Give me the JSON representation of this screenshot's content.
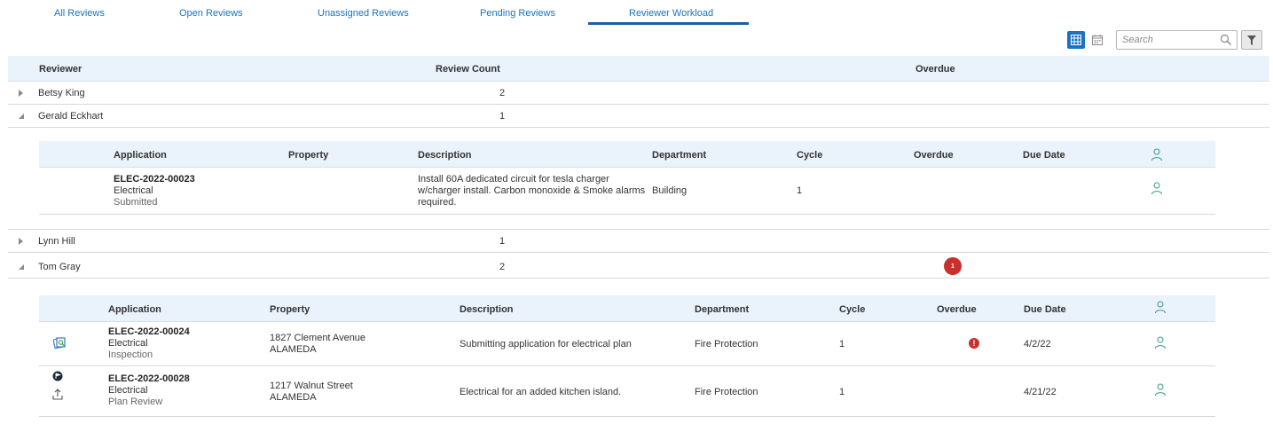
{
  "tabs": [
    {
      "label": "All Reviews"
    },
    {
      "label": "Open Reviews"
    },
    {
      "label": "Unassigned Reviews"
    },
    {
      "label": "Pending Reviews"
    },
    {
      "label": "Reviewer Workload",
      "active": true
    }
  ],
  "toolbar": {
    "search_placeholder": "Search",
    "icons": [
      "grid-view-icon",
      "calendar-view-icon",
      "search-icon",
      "filter-icon"
    ]
  },
  "colors": {
    "accent": "#1a73c0",
    "header_bg": "#eaf2fb",
    "overdue": "#c9302c"
  },
  "outer_headers": {
    "reviewer": "Reviewer",
    "review_count": "Review Count",
    "overdue": "Overdue"
  },
  "inner_headers": {
    "application": "Application",
    "property": "Property",
    "description": "Description",
    "department": "Department",
    "cycle": "Cycle",
    "overdue": "Overdue",
    "due_date": "Due Date"
  },
  "reviewers": [
    {
      "name": "Betsy King",
      "count": "2",
      "expanded": false
    },
    {
      "name": "Gerald Eckhart",
      "count": "1",
      "expanded": true,
      "reviews": [
        {
          "app_number": "ELEC-2022-00023",
          "app_type": "Electrical",
          "app_status": "Submitted",
          "property": "",
          "description_lines": [
            "Install 60A dedicated circuit for tesla charger",
            "w/charger install. Carbon monoxide & Smoke alarms",
            "required."
          ],
          "department": "Building",
          "cycle": "1",
          "due_date": ""
        }
      ]
    },
    {
      "name": "Lynn Hill",
      "count": "1",
      "expanded": false
    },
    {
      "name": "Tom Gray",
      "count": "2",
      "overdue_count": "1",
      "expanded": true,
      "reviews": [
        {
          "app_number": "ELEC-2022-00024",
          "app_type": "Electrical",
          "app_status": "Inspection",
          "property_line1": "1827 Clement Avenue",
          "property_line2": "ALAMEDA",
          "description": "Submitting application for electrical plan",
          "department": "Fire Protection",
          "cycle": "1",
          "overdue_mark": "!",
          "due_date": "4/2/22"
        },
        {
          "app_number": "ELEC-2022-00028",
          "app_type": "Electrical",
          "app_status": "Plan Review",
          "property_line1": "1217 Walnut Street",
          "property_line2": "ALAMEDA",
          "description": "Electrical for an added kitchen island.",
          "department": "Fire Protection",
          "cycle": "1",
          "due_date": "4/21/22"
        }
      ]
    }
  ]
}
